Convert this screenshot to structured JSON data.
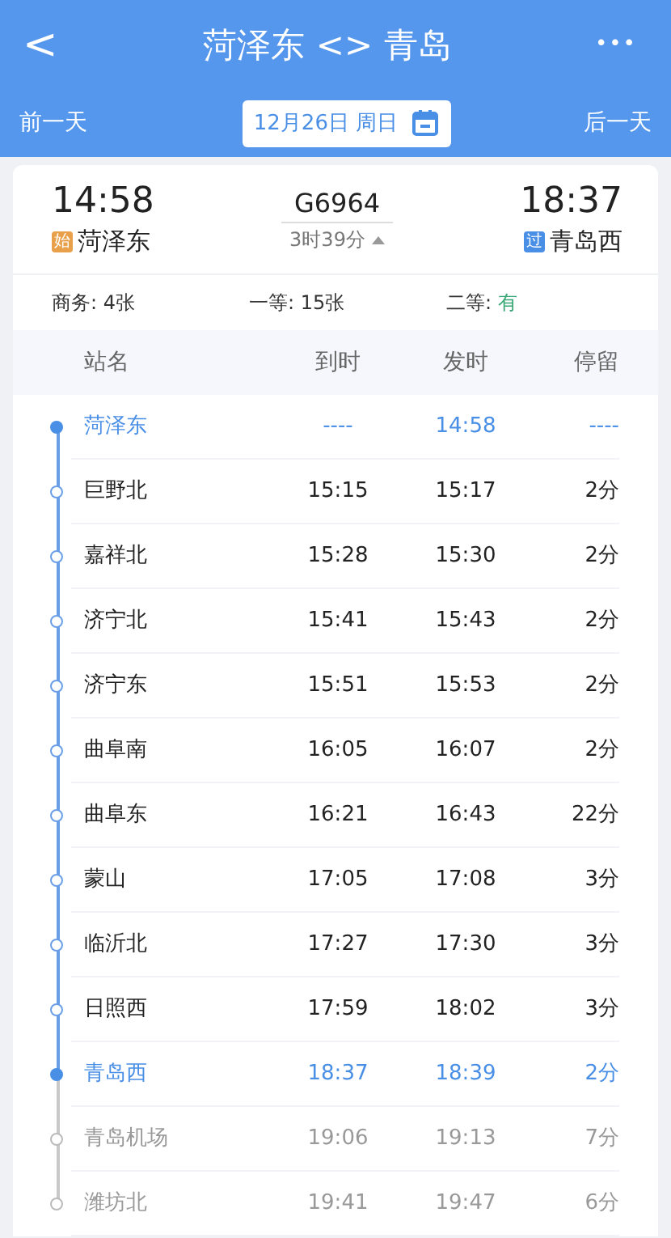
{
  "nav": {
    "back": "<",
    "title": "菏泽东 <> 青岛",
    "more": "•••"
  },
  "date_bar": {
    "prev": "前一天",
    "date": "12月26日 周日",
    "next": "后一天"
  },
  "train": {
    "number": "G6964",
    "duration": "3时39分",
    "expanded": true,
    "from": {
      "time": "14:58",
      "badge": "始",
      "station": "菏泽东",
      "color": "#e8a04a"
    },
    "to": {
      "time": "18:37",
      "badge": "过",
      "station": "青岛西",
      "color": "#4a8fe6"
    }
  },
  "seats": [
    {
      "label": "商务: ",
      "value": "4张",
      "color": "#333333"
    },
    {
      "label": "一等: ",
      "value": "15张",
      "color": "#333333"
    },
    {
      "label": "二等: ",
      "value": "有",
      "color": "#3aa876"
    }
  ],
  "table": {
    "columns": [
      "站名",
      "到时",
      "发时",
      "停留"
    ],
    "rows": [
      {
        "station": "菏泽东",
        "arrive": "----",
        "depart": "14:58",
        "stay": "----",
        "kind": "endpoint"
      },
      {
        "station": "巨野北",
        "arrive": "15:15",
        "depart": "15:17",
        "stay": "2分",
        "kind": "route"
      },
      {
        "station": "嘉祥北",
        "arrive": "15:28",
        "depart": "15:30",
        "stay": "2分",
        "kind": "route"
      },
      {
        "station": "济宁北",
        "arrive": "15:41",
        "depart": "15:43",
        "stay": "2分",
        "kind": "route"
      },
      {
        "station": "济宁东",
        "arrive": "15:51",
        "depart": "15:53",
        "stay": "2分",
        "kind": "route"
      },
      {
        "station": "曲阜南",
        "arrive": "16:05",
        "depart": "16:07",
        "stay": "2分",
        "kind": "route"
      },
      {
        "station": "曲阜东",
        "arrive": "16:21",
        "depart": "16:43",
        "stay": "22分",
        "kind": "route"
      },
      {
        "station": "蒙山",
        "arrive": "17:05",
        "depart": "17:08",
        "stay": "3分",
        "kind": "route"
      },
      {
        "station": "临沂北",
        "arrive": "17:27",
        "depart": "17:30",
        "stay": "3分",
        "kind": "route"
      },
      {
        "station": "日照西",
        "arrive": "17:59",
        "depart": "18:02",
        "stay": "3分",
        "kind": "route"
      },
      {
        "station": "青岛西",
        "arrive": "18:37",
        "depart": "18:39",
        "stay": "2分",
        "kind": "endpoint"
      },
      {
        "station": "青岛机场",
        "arrive": "19:06",
        "depart": "19:13",
        "stay": "7分",
        "kind": "beyond"
      },
      {
        "station": "潍坊北",
        "arrive": "19:41",
        "depart": "19:47",
        "stay": "6分",
        "kind": "beyond"
      }
    ]
  }
}
